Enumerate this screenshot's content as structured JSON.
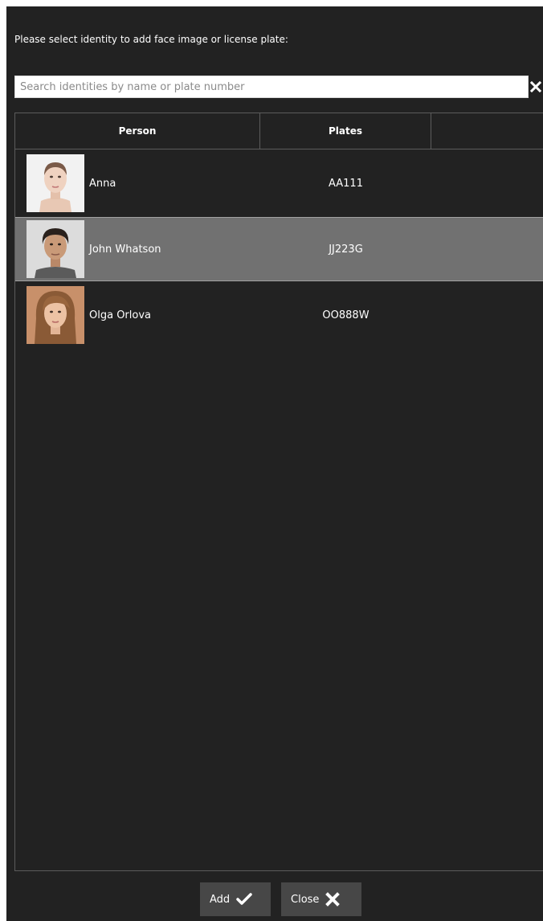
{
  "dialog": {
    "prompt": "Please select identity to add face image or license plate:"
  },
  "search": {
    "placeholder": "Search identities by name or plate number",
    "value": ""
  },
  "table": {
    "columns": [
      "Person",
      "Plates",
      ""
    ],
    "rows": [
      {
        "name": "Anna",
        "plate": "AA111",
        "selected": false
      },
      {
        "name": "John Whatson",
        "plate": "JJ223G",
        "selected": true
      },
      {
        "name": "Olga Orlova",
        "plate": "OO888W",
        "selected": false
      }
    ]
  },
  "buttons": {
    "add_label": "Add",
    "close_label": "Close"
  },
  "icons": {
    "clear": "close-icon",
    "add": "checkmark-icon",
    "close": "close-icon"
  },
  "colors": {
    "background": "#222222",
    "selected_row": "#717171",
    "button": "#474747",
    "border": "#5c5c5c"
  }
}
